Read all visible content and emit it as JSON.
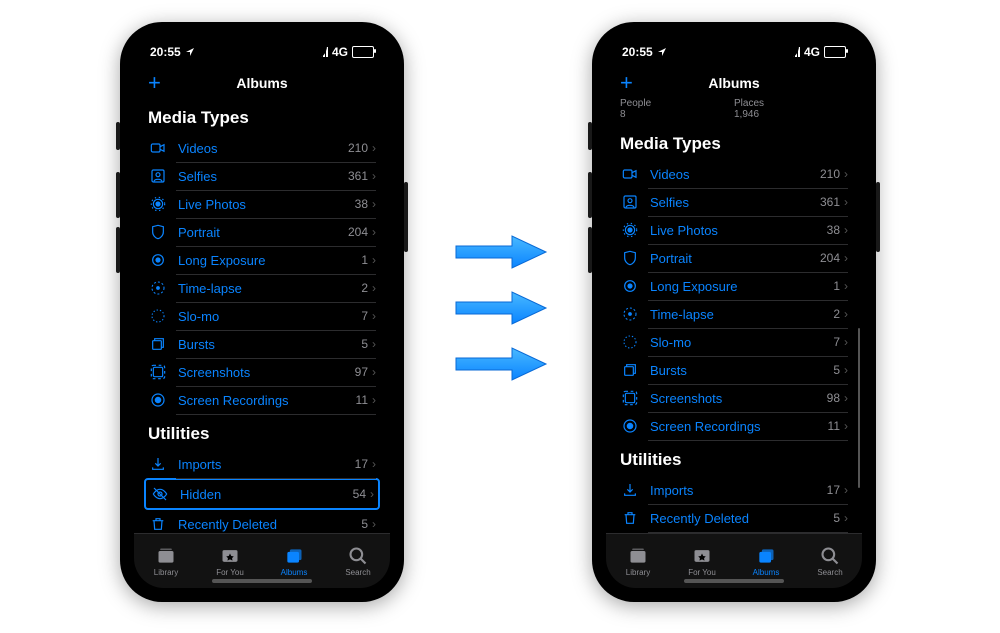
{
  "status": {
    "time": "20:55",
    "network": "4G"
  },
  "nav": {
    "title": "Albums",
    "plus": "+"
  },
  "sections": {
    "media_types": "Media Types",
    "utilities": "Utilities"
  },
  "left": {
    "media": [
      {
        "icon": "video",
        "label": "Videos",
        "count": "210"
      },
      {
        "icon": "selfie",
        "label": "Selfies",
        "count": "361"
      },
      {
        "icon": "live",
        "label": "Live Photos",
        "count": "38"
      },
      {
        "icon": "portrait",
        "label": "Portrait",
        "count": "204"
      },
      {
        "icon": "longexp",
        "label": "Long Exposure",
        "count": "1"
      },
      {
        "icon": "timelapse",
        "label": "Time-lapse",
        "count": "2"
      },
      {
        "icon": "slomo",
        "label": "Slo-mo",
        "count": "7"
      },
      {
        "icon": "bursts",
        "label": "Bursts",
        "count": "5"
      },
      {
        "icon": "screenshot",
        "label": "Screenshots",
        "count": "97"
      },
      {
        "icon": "screenrec",
        "label": "Screen Recordings",
        "count": "11"
      }
    ],
    "utilities": [
      {
        "icon": "import",
        "label": "Imports",
        "count": "17"
      },
      {
        "icon": "hidden",
        "label": "Hidden",
        "count": "54",
        "hl": true
      },
      {
        "icon": "trash",
        "label": "Recently Deleted",
        "count": "5"
      }
    ]
  },
  "right": {
    "top": [
      {
        "t": "People",
        "v": "8"
      },
      {
        "t": "Places",
        "v": "1,946"
      }
    ],
    "media": [
      {
        "icon": "video",
        "label": "Videos",
        "count": "210"
      },
      {
        "icon": "selfie",
        "label": "Selfies",
        "count": "361"
      },
      {
        "icon": "live",
        "label": "Live Photos",
        "count": "38"
      },
      {
        "icon": "portrait",
        "label": "Portrait",
        "count": "204"
      },
      {
        "icon": "longexp",
        "label": "Long Exposure",
        "count": "1"
      },
      {
        "icon": "timelapse",
        "label": "Time-lapse",
        "count": "2"
      },
      {
        "icon": "slomo",
        "label": "Slo-mo",
        "count": "7"
      },
      {
        "icon": "bursts",
        "label": "Bursts",
        "count": "5"
      },
      {
        "icon": "screenshot",
        "label": "Screenshots",
        "count": "98"
      },
      {
        "icon": "screenrec",
        "label": "Screen Recordings",
        "count": "11"
      }
    ],
    "utilities": [
      {
        "icon": "import",
        "label": "Imports",
        "count": "17"
      },
      {
        "icon": "trash",
        "label": "Recently Deleted",
        "count": "5"
      }
    ]
  },
  "tabs": [
    {
      "id": "library",
      "label": "Library"
    },
    {
      "id": "foryou",
      "label": "For You"
    },
    {
      "id": "albums",
      "label": "Albums"
    },
    {
      "id": "search",
      "label": "Search"
    }
  ],
  "active_tab": "albums"
}
